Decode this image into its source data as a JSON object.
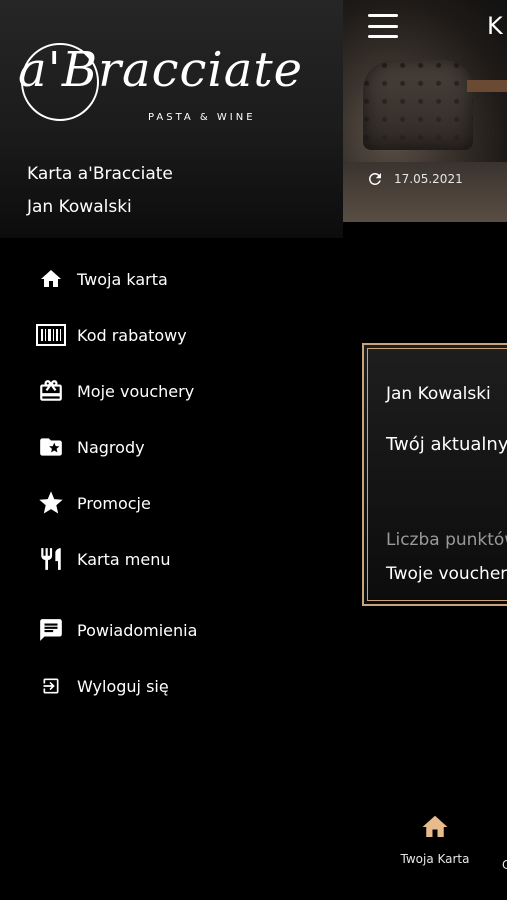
{
  "app": {
    "title_partial": "K",
    "updated_date": "17.05.2021"
  },
  "card": {
    "name": "Jan Kowalski",
    "current_label": "Twój aktualny",
    "points_label": "Liczba punktów",
    "vouchers_label": "Twoje voucher"
  },
  "bottom_nav": {
    "home_label": "Twoja Karta",
    "next_partial": "C"
  },
  "drawer": {
    "logo_text": "a'Bracciate",
    "logo_sub": "PASTA & WINE",
    "card_title": "Karta a'Bracciate",
    "user_name": "Jan Kowalski",
    "items": [
      {
        "label": "Twoja karta",
        "icon": "home-icon"
      },
      {
        "label": "Kod rabatowy",
        "icon": "barcode-icon"
      },
      {
        "label": "Moje vouchery",
        "icon": "gift-card-icon"
      },
      {
        "label": "Nagrody",
        "icon": "folder-star-icon"
      },
      {
        "label": "Promocje",
        "icon": "star-icon"
      },
      {
        "label": "Karta menu",
        "icon": "cutlery-icon"
      },
      {
        "label": "Powiadomienia",
        "icon": "message-icon"
      },
      {
        "label": "Wyloguj się",
        "icon": "logout-icon"
      }
    ]
  },
  "colors": {
    "accent_gold": "#c8a47a",
    "background": "#000000",
    "text": "#ffffff",
    "muted": "#9a9a9a"
  }
}
